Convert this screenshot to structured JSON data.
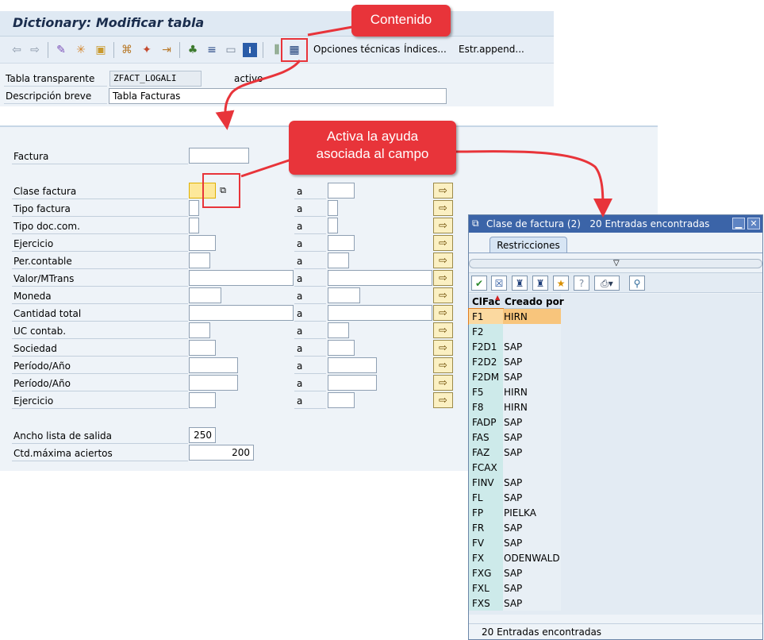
{
  "window": {
    "title": "Dictionary: Modificar tabla"
  },
  "toolbar": {
    "icons": [
      "back-arrow-icon",
      "forward-arrow-icon",
      "glasses-pencil-icon",
      "display-change-icon",
      "clipboard-icon",
      "hierarchy-icon",
      "magic-wand-icon",
      "arrow-out-icon",
      "org-chart-icon",
      "stack-icon",
      "window-icon",
      "info-icon",
      "column-icon",
      "contents-table-icon"
    ],
    "technical_options": "Opciones técnicas",
    "indices": "Índices...",
    "append_structure": "Estr.append..."
  },
  "header": {
    "table_label": "Tabla transparente",
    "table_value": "ZFACT_LOGALI",
    "status": "activo",
    "description_label": "Descripción breve",
    "description_value": "Tabla Facturas"
  },
  "selection": {
    "to_label": "a",
    "fields": [
      {
        "label": "Factura",
        "value": ""
      },
      {
        "label": "Clase factura",
        "value": ""
      },
      {
        "label": "Tipo factura",
        "value": ""
      },
      {
        "label": "Tipo doc.com.",
        "value": ""
      },
      {
        "label": "Ejercicio",
        "value": ""
      },
      {
        "label": "Per.contable",
        "value": ""
      },
      {
        "label": "Valor/MTrans",
        "value": ""
      },
      {
        "label": "Moneda",
        "value": ""
      },
      {
        "label": "Cantidad total",
        "value": ""
      },
      {
        "label": "UC contab.",
        "value": ""
      },
      {
        "label": "Sociedad",
        "value": ""
      },
      {
        "label": "Período/Año",
        "value": ""
      },
      {
        "label": "Período/Año",
        "value": ""
      },
      {
        "label": "Ejercicio",
        "value": ""
      }
    ],
    "output_width_label": "Ancho lista de salida",
    "output_width_value": "250",
    "max_hits_label": "Ctd.máxima aciertos",
    "max_hits_value": "200"
  },
  "popup": {
    "title": "Clase de factura (2)",
    "title_count": "20 Entradas encontradas",
    "tab": "Restricciones",
    "columns": [
      "ClFac",
      "Creado por"
    ],
    "rows": [
      [
        "F1",
        "HIRN"
      ],
      [
        "F2",
        ""
      ],
      [
        "F2D1",
        "SAP"
      ],
      [
        "F2D2",
        "SAP"
      ],
      [
        "F2DM",
        "SAP"
      ],
      [
        "F5",
        "HIRN"
      ],
      [
        "F8",
        "HIRN"
      ],
      [
        "FADP",
        "SAP"
      ],
      [
        "FAS",
        "SAP"
      ],
      [
        "FAZ",
        "SAP"
      ],
      [
        "FCAX",
        ""
      ],
      [
        "FINV",
        "SAP"
      ],
      [
        "FL",
        "SAP"
      ],
      [
        "FP",
        "PIELKA"
      ],
      [
        "FR",
        "SAP"
      ],
      [
        "FV",
        "SAP"
      ],
      [
        "FX",
        "ODENWALD"
      ],
      [
        "FXG",
        "SAP"
      ],
      [
        "FXL",
        "SAP"
      ],
      [
        "FXS",
        "SAP"
      ]
    ],
    "status": "20 Entradas encontradas"
  },
  "callouts": {
    "contenido": "Contenido",
    "ayuda_line1": "Activa la ayuda",
    "ayuda_line2": "asociada al campo"
  },
  "colors": {
    "callout": "#e8343a",
    "popup_title": "#3b64a8",
    "selected_row": "#f8c57c"
  }
}
